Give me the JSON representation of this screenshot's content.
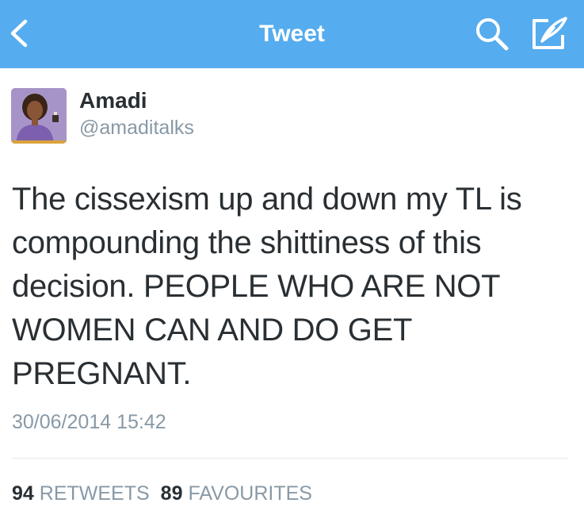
{
  "nav": {
    "title": "Tweet",
    "back_icon": "chevron-left-icon",
    "search_icon": "search-icon",
    "compose_icon": "compose-icon",
    "bar_color": "#55acee"
  },
  "tweet": {
    "author": {
      "display_name": "Amadi",
      "handle": "@amaditalks"
    },
    "text": "The cissexism up and down my TL is compounding the shittiness of this decision. PEOPLE WHO ARE NOT WOMEN CAN AND DO GET PREGNANT.",
    "timestamp": "30/06/2014 15:42"
  },
  "stats": {
    "retweets": {
      "count": "94",
      "label": "RETWEETS"
    },
    "favourites": {
      "count": "89",
      "label": "FAVOURITES"
    }
  },
  "colors": {
    "text": "#292f33",
    "muted": "#8899a6",
    "divider": "#e1e8ed"
  }
}
